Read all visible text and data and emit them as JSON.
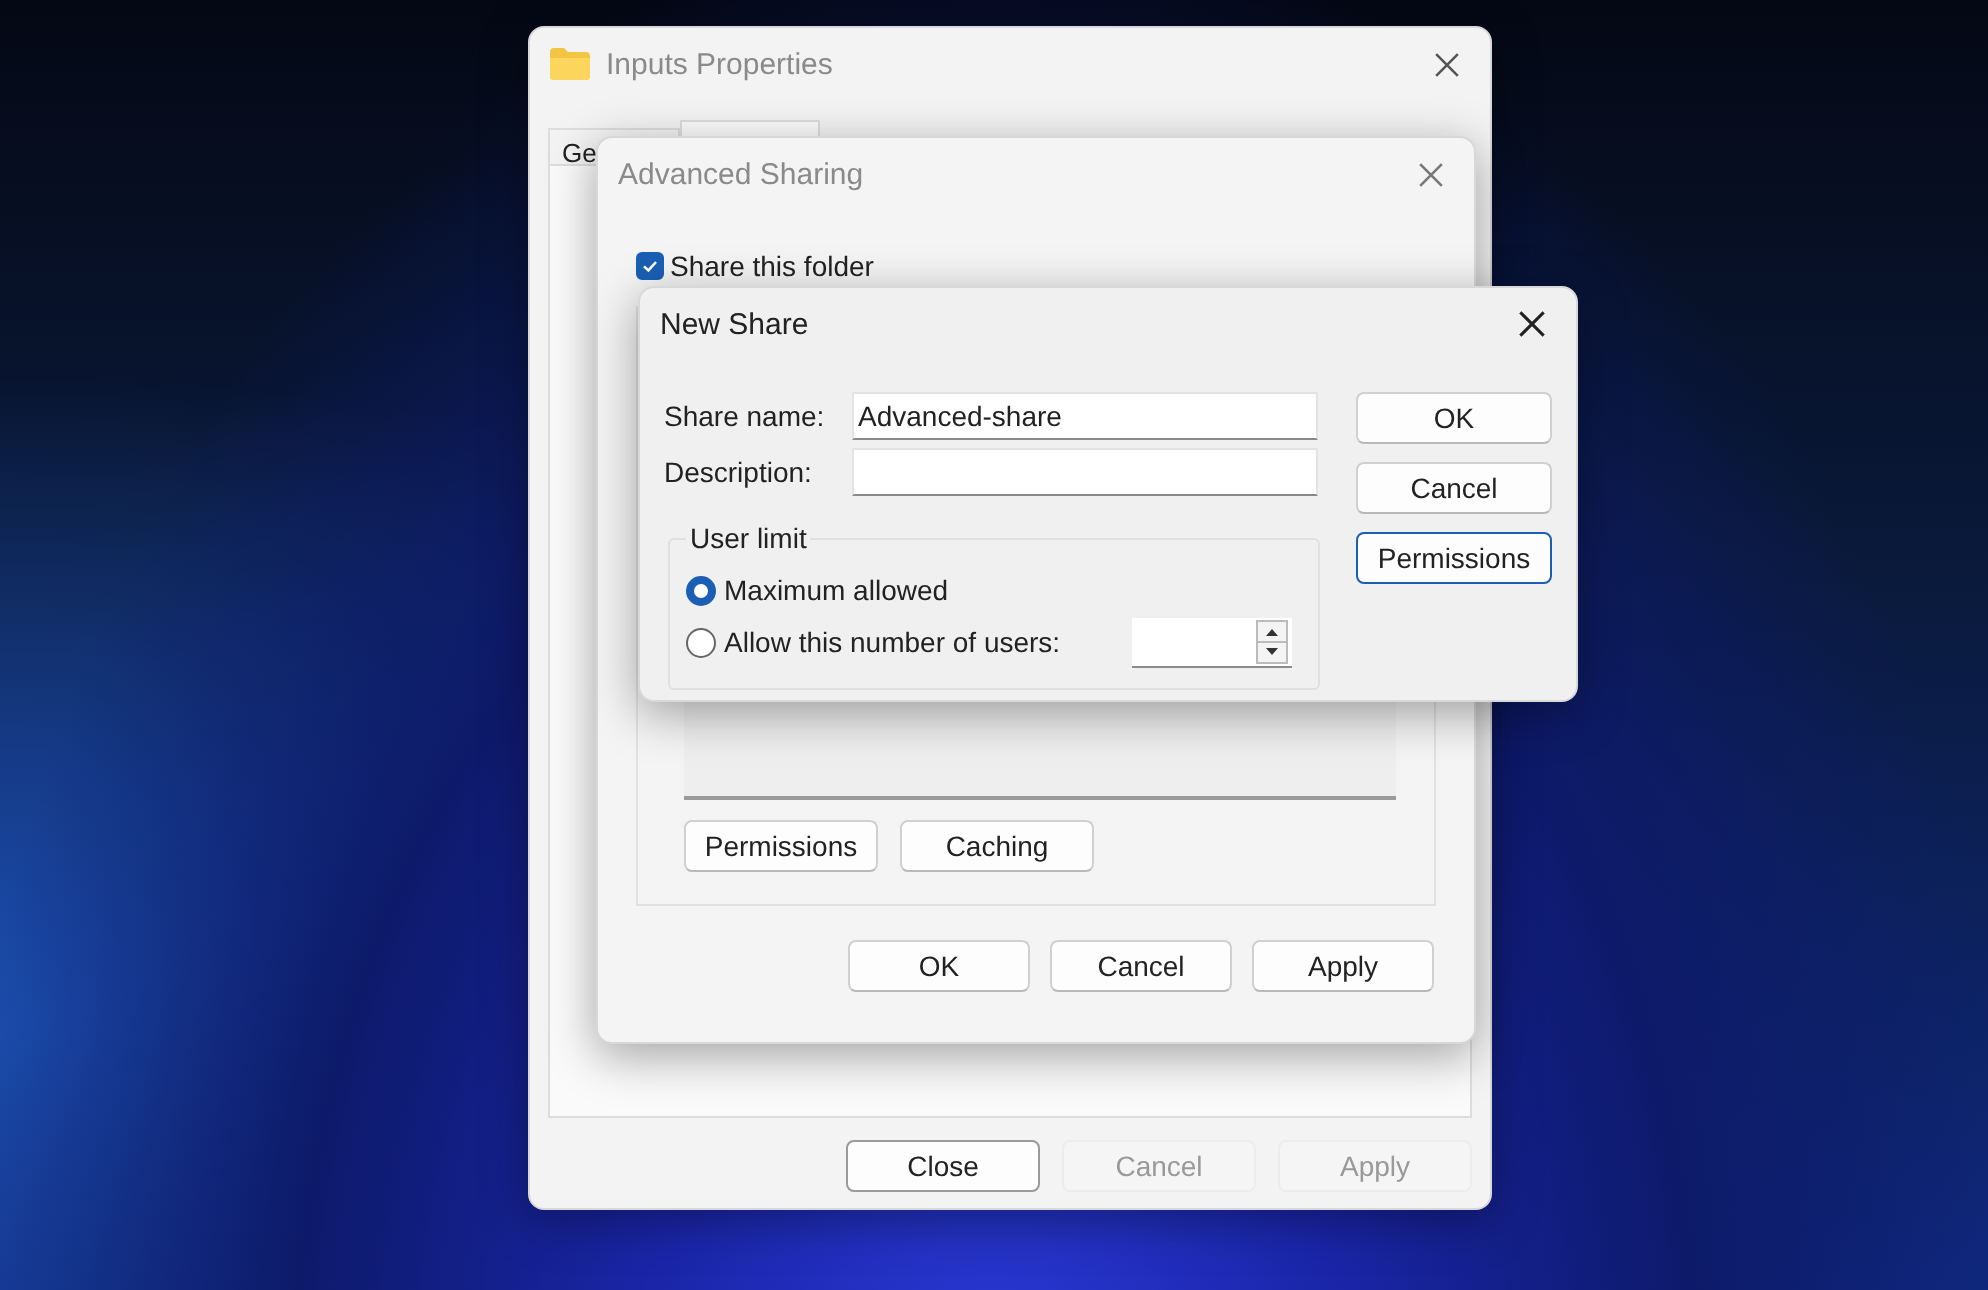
{
  "properties_window": {
    "title": "Inputs Properties",
    "tabs": [
      {
        "label": "Ge",
        "selected": false
      },
      {
        "selected": true
      }
    ],
    "buttons": [
      {
        "label": "Close",
        "disabled": false
      },
      {
        "label": "Cancel",
        "disabled": true
      },
      {
        "label": "Apply",
        "disabled": true
      }
    ]
  },
  "advanced_sharing": {
    "title": "Advanced Sharing",
    "share_checkbox": {
      "label": "Share this folder",
      "checked": true
    },
    "panel_buttons": [
      "Permissions",
      "Caching"
    ],
    "buttons": [
      "OK",
      "Cancel",
      "Apply"
    ]
  },
  "new_share": {
    "title": "New Share",
    "fields": [
      {
        "label": "Share name:",
        "value": "Advanced-share"
      },
      {
        "label": "Description:"
      }
    ],
    "user_limit": {
      "legend": "User limit",
      "options": [
        {
          "label": "Maximum allowed",
          "selected": true
        },
        {
          "label": "Allow this number of users:",
          "selected": false
        }
      ]
    },
    "buttons": [
      {
        "label": "OK",
        "focused": false
      },
      {
        "label": "Cancel",
        "focused": false
      },
      {
        "label": "Permissions",
        "focused": true
      }
    ]
  }
}
